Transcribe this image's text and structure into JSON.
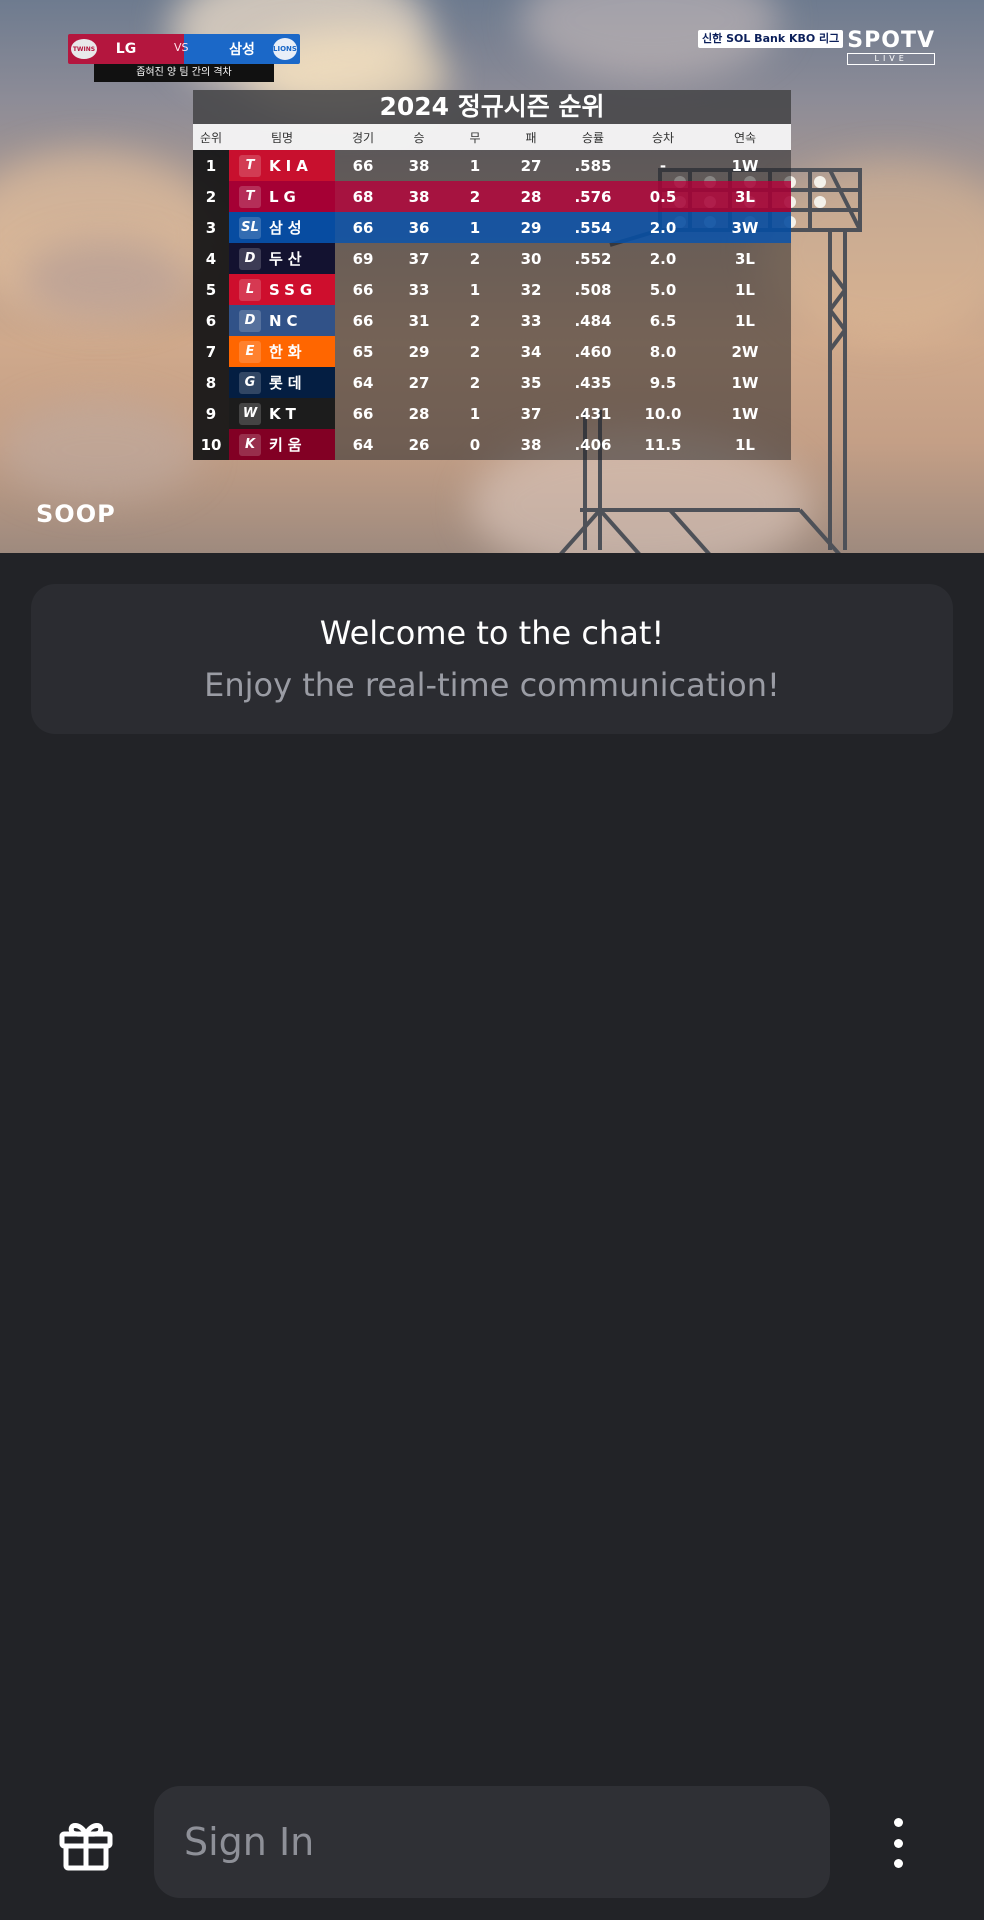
{
  "video": {
    "scorebug": {
      "home_team": "LG",
      "vs": "VS",
      "away_team": "삼성",
      "home_logo": "TWINS",
      "away_logo": "LIONS",
      "subtitle": "좁혀진 양 팀 간의 격차"
    },
    "broadcaster": {
      "sponsor": "신한 SOL Bank KBO 리그",
      "channel": "SPOTV",
      "live": "LIVE"
    },
    "watermark": "SOOP",
    "standings": {
      "title": "2024 정규시즌 순위",
      "headers": [
        "순위",
        "팀명",
        "경기",
        "승",
        "무",
        "패",
        "승률",
        "승차",
        "연속"
      ],
      "rows": [
        {
          "rank": "1",
          "logo": "T",
          "team": "KIA",
          "g": "66",
          "w": "38",
          "d": "1",
          "l": "27",
          "pct": ".585",
          "gb": "-",
          "streak": "1W",
          "color": "#c8102e"
        },
        {
          "rank": "2",
          "logo": "T",
          "team": "LG",
          "g": "68",
          "w": "38",
          "d": "2",
          "l": "28",
          "pct": ".576",
          "gb": "0.5",
          "streak": "3L",
          "color": "#a50034"
        },
        {
          "rank": "3",
          "logo": "SL",
          "team": "삼성",
          "g": "66",
          "w": "36",
          "d": "1",
          "l": "29",
          "pct": ".554",
          "gb": "2.0",
          "streak": "3W",
          "color": "#074ca1"
        },
        {
          "rank": "4",
          "logo": "D",
          "team": "두산",
          "g": "69",
          "w": "37",
          "d": "2",
          "l": "30",
          "pct": ".552",
          "gb": "2.0",
          "streak": "3L",
          "color": "#131230"
        },
        {
          "rank": "5",
          "logo": "L",
          "team": "SSG",
          "g": "66",
          "w": "33",
          "d": "1",
          "l": "32",
          "pct": ".508",
          "gb": "5.0",
          "streak": "1L",
          "color": "#ce0e2d"
        },
        {
          "rank": "6",
          "logo": "D",
          "team": "NC",
          "g": "66",
          "w": "31",
          "d": "2",
          "l": "33",
          "pct": ".484",
          "gb": "6.5",
          "streak": "1L",
          "color": "#315288"
        },
        {
          "rank": "7",
          "logo": "E",
          "team": "한화",
          "g": "65",
          "w": "29",
          "d": "2",
          "l": "34",
          "pct": ".460",
          "gb": "8.0",
          "streak": "2W",
          "color": "#ff6600"
        },
        {
          "rank": "8",
          "logo": "G",
          "team": "롯데",
          "g": "64",
          "w": "27",
          "d": "2",
          "l": "35",
          "pct": ".435",
          "gb": "9.5",
          "streak": "1W",
          "color": "#041e42"
        },
        {
          "rank": "9",
          "logo": "W",
          "team": "KT",
          "g": "66",
          "w": "28",
          "d": "1",
          "l": "37",
          "pct": ".431",
          "gb": "10.0",
          "streak": "1W",
          "color": "#1c1c1c"
        },
        {
          "rank": "10",
          "logo": "K",
          "team": "키움",
          "g": "64",
          "w": "26",
          "d": "0",
          "l": "38",
          "pct": ".406",
          "gb": "11.5",
          "streak": "1L",
          "color": "#820024"
        }
      ]
    }
  },
  "chat": {
    "welcome_title": "Welcome to the chat!",
    "welcome_subtitle": "Enjoy the real-time communication!"
  },
  "bottom_bar": {
    "gift_icon": "gift-icon",
    "input_placeholder": "Sign In",
    "more_icon": "more-vertical-icon"
  }
}
